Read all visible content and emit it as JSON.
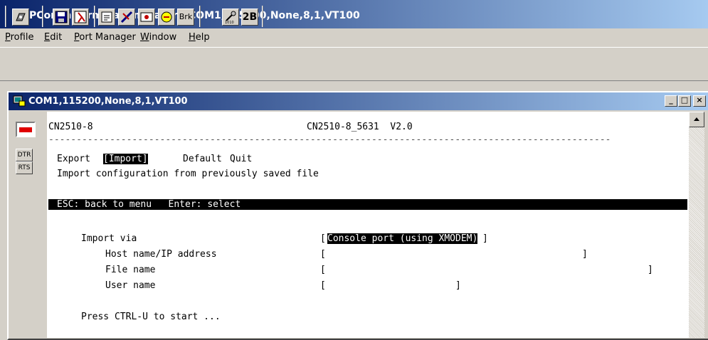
{
  "window": {
    "title": "PComm Terminal Emulator - COM1,115200,None,8,1,VT100"
  },
  "menu": {
    "items": [
      {
        "label": "Profile"
      },
      {
        "label": "Edit"
      },
      {
        "label": "Port Manager"
      },
      {
        "label": "Window"
      },
      {
        "label": "Help"
      }
    ]
  },
  "toolbar": {
    "buttons": [
      {
        "icon": "connect-icon"
      },
      {
        "icon": "save-icon"
      },
      {
        "icon": "exit-icon"
      },
      {
        "icon": "properties-icon"
      },
      {
        "icon": "send-file-icon"
      },
      {
        "icon": "capture-icon"
      },
      {
        "icon": "macro-icon"
      },
      {
        "label": "Brk"
      },
      {
        "icon": "transfer-icon"
      },
      {
        "label": "2B"
      }
    ]
  },
  "child_window": {
    "title": "COM1,115200,None,8,1,VT100",
    "controls": [
      "_",
      "□",
      "×"
    ]
  },
  "side_panel": {
    "indicators": [
      {
        "label": "DTR"
      },
      {
        "label": "RTS"
      }
    ],
    "status_color": "#e00000"
  },
  "terminal": {
    "device": "CN2510-8",
    "model_version": "CN2510-8_5631  V2.0",
    "separator": "-----------------------------------------------------------------------------------------------------",
    "menu_options": {
      "export": "Export",
      "import": "[Import]",
      "default": "Default",
      "quit": "Quit"
    },
    "description": "Import configuration from previously saved file",
    "hint_bar": "ESC: back to menu   Enter: select",
    "fields": [
      {
        "label": "Import via",
        "value": "Console port (using XMODEM)"
      },
      {
        "label": "Host name/IP address",
        "value": ""
      },
      {
        "label": "File name",
        "value": ""
      },
      {
        "label": "User name",
        "value": ""
      }
    ],
    "footer": "Press CTRL-U to start ..."
  }
}
